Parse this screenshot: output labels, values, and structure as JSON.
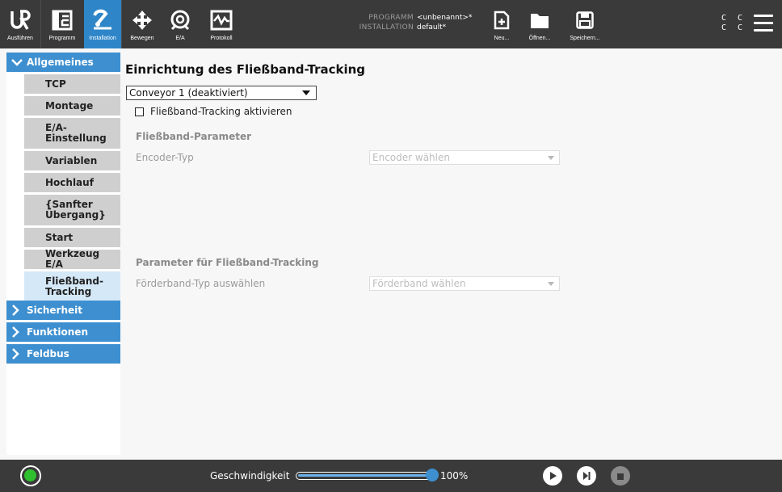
{
  "topbar": {
    "tabs": [
      {
        "label": "Ausführen",
        "icon": "ur-logo-icon"
      },
      {
        "label": "Programm",
        "icon": "program-tree-icon"
      },
      {
        "label": "Installation",
        "icon": "installation-icon",
        "active": true
      }
    ],
    "tools": [
      {
        "label": "Bewegen",
        "icon": "move-arrows-icon"
      },
      {
        "label": "E/A",
        "icon": "io-icon"
      },
      {
        "label": "Protokoll",
        "icon": "log-icon"
      }
    ],
    "program_key": "PROGRAMM",
    "program_value": "<unbenannt>*",
    "installation_key": "INSTALLATION",
    "installation_value": "default*",
    "file_actions": [
      {
        "label": "Neu...",
        "icon": "new-file-icon"
      },
      {
        "label": "Öffnen...",
        "icon": "folder-icon"
      },
      {
        "label": "Speichern...",
        "icon": "save-icon"
      }
    ],
    "cc_line1": "C C",
    "cc_line2": "C C"
  },
  "sidebar": {
    "sections": [
      {
        "label": "Allgemeines",
        "expanded": true
      },
      {
        "label": "Sicherheit",
        "expanded": false
      },
      {
        "label": "Funktionen",
        "expanded": false
      },
      {
        "label": "Feldbus",
        "expanded": false
      }
    ],
    "items": [
      {
        "label": "TCP"
      },
      {
        "label": "Montage"
      },
      {
        "label": "E/A-Einstellung",
        "lines": [
          "E/A-",
          "Einstellung"
        ]
      },
      {
        "label": "Variablen"
      },
      {
        "label": "Hochlauf"
      },
      {
        "label": "{Sanfter Übergang}",
        "lines": [
          "{Sanfter",
          "Übergang}"
        ]
      },
      {
        "label": "Start"
      },
      {
        "label": "Werkzeug E/A"
      },
      {
        "label": "Fließband-Tracking",
        "lines": [
          "Fließband-",
          "Tracking"
        ],
        "active": true
      }
    ]
  },
  "main": {
    "title": "Einrichtung des Fließband-Tracking",
    "conveyor_select": "Conveyor 1 (deaktiviert)",
    "enable_label": "Fließband-Tracking aktivieren",
    "enable_checked": false,
    "params_heading": "Fließband-Parameter",
    "encoder_label": "Encoder-Typ",
    "encoder_placeholder": "Encoder wählen",
    "tracking_heading": "Parameter für Fließband-Tracking",
    "conveyor_type_label": "Förderband-Typ auswählen",
    "conveyor_type_placeholder": "Förderband wählen"
  },
  "bottombar": {
    "speed_label": "Geschwindigkeit",
    "speed_value": "100%",
    "speed_fraction": 1.0,
    "power_status_color": "#2ec02e"
  },
  "colors": {
    "accent": "#3d8fd0",
    "topbar_bg": "#3a3a3a",
    "active_item": "#d4e8f7"
  }
}
